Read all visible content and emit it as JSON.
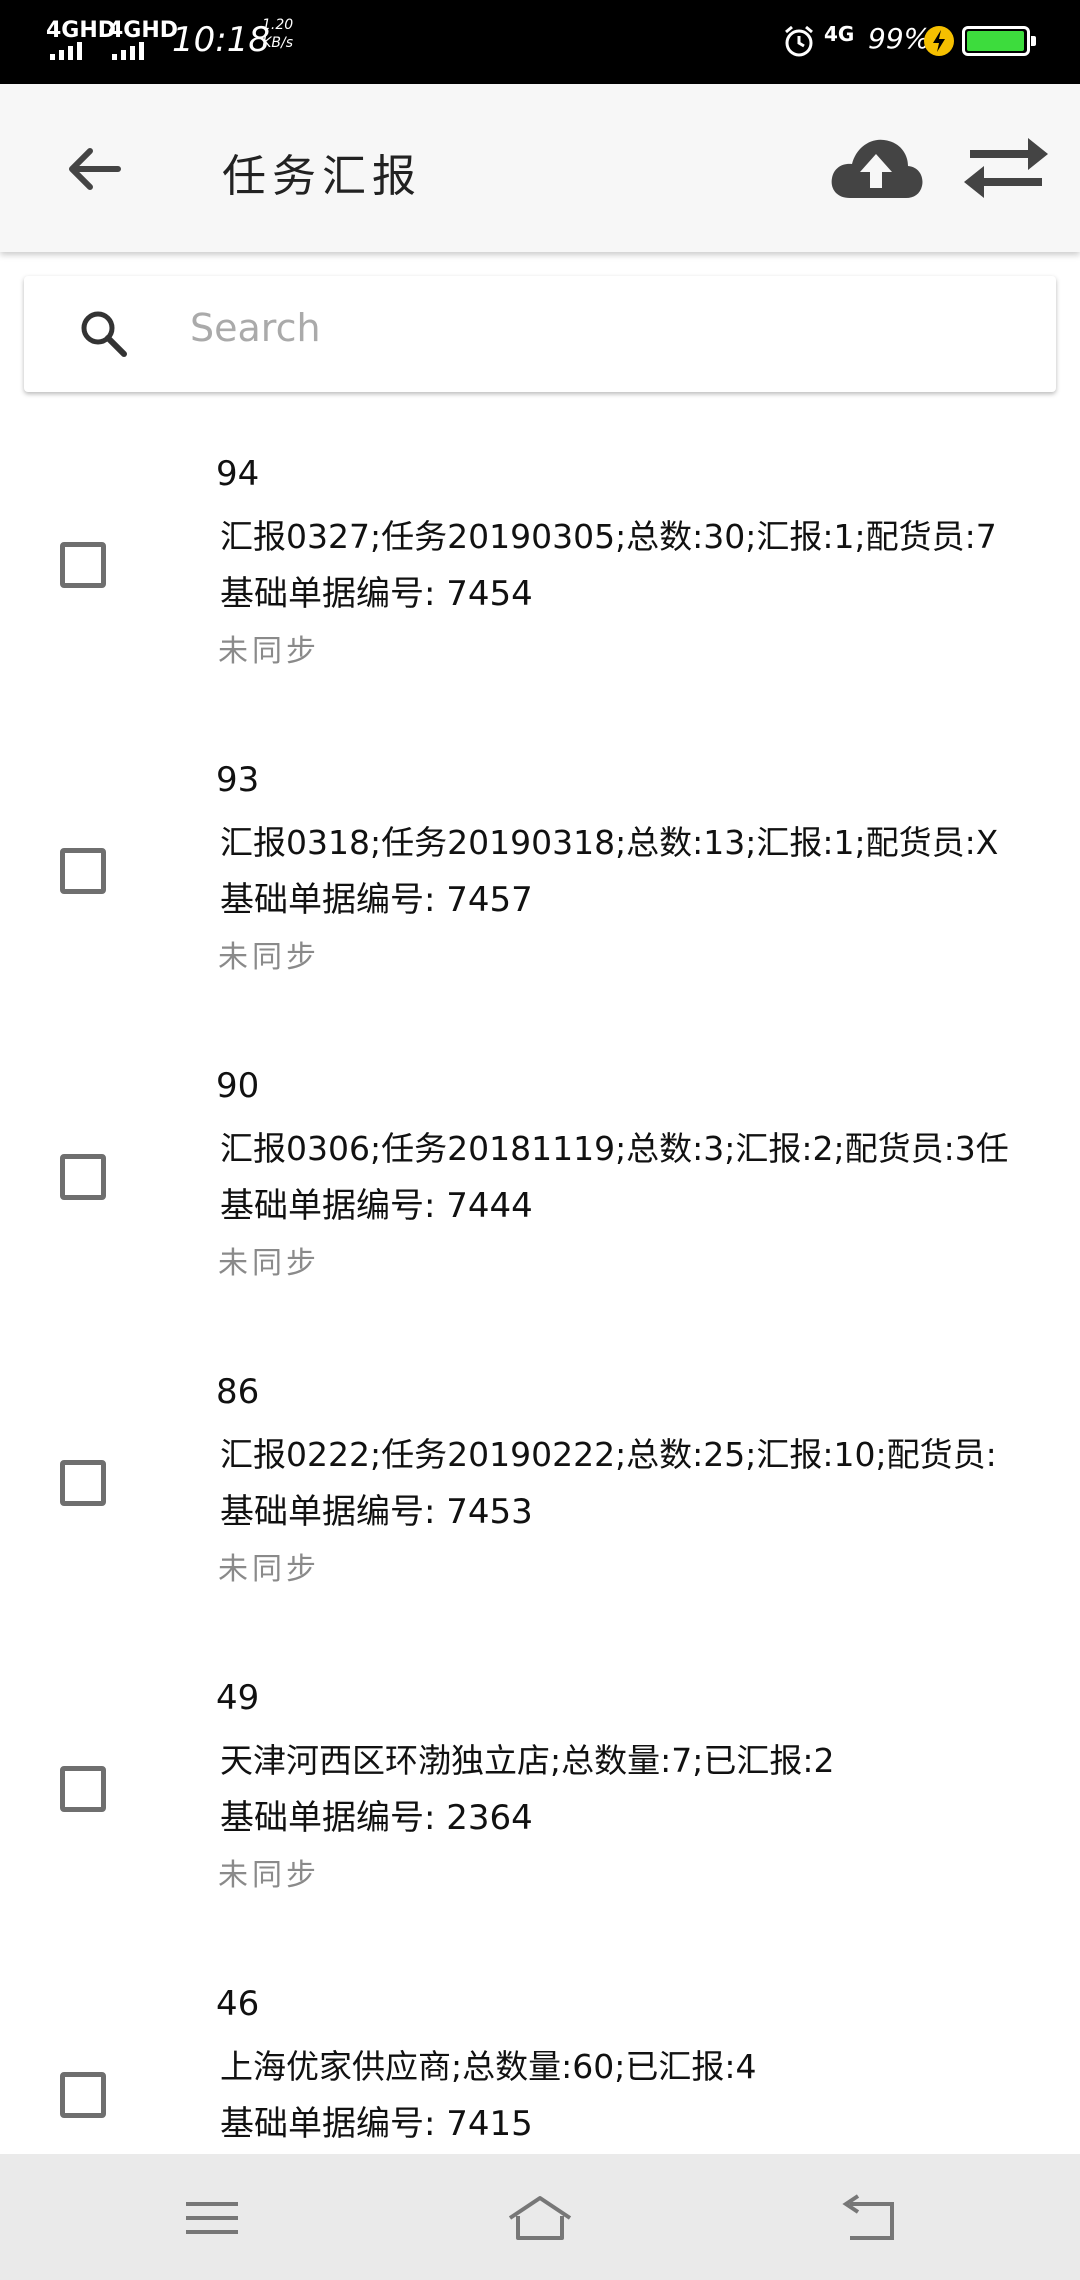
{
  "status_bar": {
    "sim1": "4GHD",
    "sim2": "4GHD",
    "time": "10:18",
    "speed_value": "1.20",
    "speed_unit": "KB/s",
    "network": "4G",
    "battery_pct": "99%",
    "battery_level": 0.99
  },
  "app_bar": {
    "title": "任务汇报",
    "back_icon": "arrow-left-icon",
    "upload_icon": "cloud-upload-icon",
    "swap_icon": "swap-arrows-icon"
  },
  "search": {
    "placeholder": "Search",
    "icon": "search-icon"
  },
  "items": [
    {
      "id": "94",
      "desc": "汇报0327;任务20190305;总数:30;汇报:1;配货员:7",
      "code": "基础单据编号: 7454",
      "status": "未同步",
      "checked": false
    },
    {
      "id": "93",
      "desc": "汇报0318;任务20190318;总数:13;汇报:1;配货员:X",
      "code": "基础单据编号: 7457",
      "status": "未同步",
      "checked": false
    },
    {
      "id": "90",
      "desc": "汇报0306;任务20181119;总数:3;汇报:2;配货员:3任",
      "code": "基础单据编号: 7444",
      "status": "未同步",
      "checked": false
    },
    {
      "id": "86",
      "desc": "汇报0222;任务20190222;总数:25;汇报:10;配货员:",
      "code": "基础单据编号: 7453",
      "status": "未同步",
      "checked": false
    },
    {
      "id": "49",
      "desc": "天津河西区环渤独立店;总数量:7;已汇报:2",
      "code": "基础单据编号: 2364",
      "status": "未同步",
      "checked": false
    },
    {
      "id": "46",
      "desc": "上海优家供应商;总数量:60;已汇报:4",
      "code": "基础单据编号: 7415",
      "status": "",
      "checked": false
    }
  ],
  "nav_bar": {
    "menu_icon": "menu-icon",
    "home_icon": "home-icon",
    "back_icon": "nav-back-icon"
  }
}
